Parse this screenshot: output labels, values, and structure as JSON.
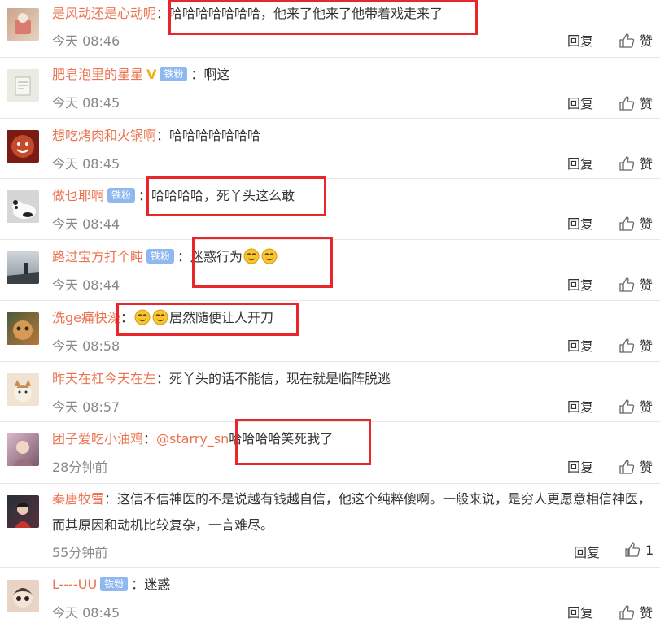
{
  "comments": [
    {
      "username": "是风动还是心动呢",
      "badge": "",
      "text": "哈哈哈哈哈哈哈，他来了他来了他带着戏走来了",
      "time": "今天 08:46",
      "reply": "回复",
      "like": "赞",
      "colors": [
        "#c9a58a",
        "#e8d2c0"
      ]
    },
    {
      "username": "肥皂泡里的星星",
      "badge": "铁粉",
      "text": "啊这",
      "time": "今天 08:45",
      "reply": "回复",
      "like": "赞",
      "colors": [
        "#e8ece3",
        "#c6cbbd"
      ]
    },
    {
      "username": "想吃烤肉和火锅啊",
      "badge": "",
      "text": "哈哈哈哈哈哈哈",
      "time": "今天 08:45",
      "reply": "回复",
      "like": "赞",
      "colors": [
        "#7a1c14",
        "#c34a2b"
      ]
    },
    {
      "username": "做乜耶啊",
      "badge": "铁粉",
      "text": "哈哈哈哈，死丫头这么敢",
      "time": "今天 08:44",
      "reply": "回复",
      "like": "赞",
      "colors": [
        "#d6d6d6",
        "#333333"
      ]
    },
    {
      "username": "路过宝方打个盹",
      "badge": "铁粉",
      "text": "迷惑行为",
      "time": "今天 08:44",
      "reply": "回复",
      "like": "赞",
      "colors": [
        "#cfd5db",
        "#3b3f46"
      ]
    },
    {
      "username": "洗ge痛快澡",
      "badge": "",
      "text": "居然随便让人开刀",
      "time": "今天 08:58",
      "reply": "回复",
      "like": "赞",
      "colors": [
        "#b7763a",
        "#4b5c3a"
      ]
    },
    {
      "username": "昨天在杠今天在左",
      "badge": "",
      "text": "死丫头的话不能信，现在就是临阵脱逃",
      "time": "今天 08:57",
      "reply": "回复",
      "like": "赞",
      "colors": [
        "#f0e3d2",
        "#c98a55"
      ]
    },
    {
      "username": "团子爱吃小油鸡",
      "badge": "",
      "mention": "@starry_sn",
      "text": "哈哈哈哈笑死我了",
      "time": "28分钟前",
      "reply": "回复",
      "like": "赞",
      "colors": [
        "#d9b8c8",
        "#7a5a6a"
      ]
    },
    {
      "username": "秦唐牧雪",
      "badge": "",
      "text": "这信不信神医的不是说越有钱越自信，他这个纯粹傻啊。一般来说，是穷人更愿意相信神医，而其原因和动机比较复杂，一言难尽。",
      "time": "55分钟前",
      "reply": "回复",
      "like": "1",
      "colors": [
        "#2a2f3a",
        "#c7362e"
      ]
    },
    {
      "username": "L----UU",
      "badge": "铁粉",
      "text": "迷惑",
      "time": "今天 08:45",
      "reply": "回复",
      "like": "赞",
      "colors": [
        "#e8d3c4",
        "#4a3b35"
      ]
    }
  ]
}
